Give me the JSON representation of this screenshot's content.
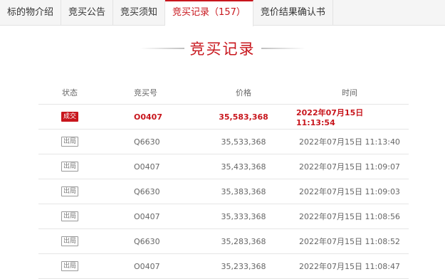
{
  "tabs": [
    {
      "label": "标的物介绍"
    },
    {
      "label": "竞买公告"
    },
    {
      "label": "竞买须知"
    },
    {
      "label": "竞买记录（157）"
    },
    {
      "label": "竞价结果确认书"
    }
  ],
  "active_tab": 3,
  "section_title": "竞买记录",
  "table": {
    "headers": {
      "status": "状态",
      "bid_no": "竞买号",
      "price": "价格",
      "time": "时间"
    },
    "rows": [
      {
        "status": "成交",
        "bid_no": "O0407",
        "price": "35,583,368",
        "time": "2022年07月15日 11:13:54",
        "winner": true
      },
      {
        "status": "出局",
        "bid_no": "Q6630",
        "price": "35,533,368",
        "time": "2022年07月15日 11:13:40",
        "winner": false
      },
      {
        "status": "出局",
        "bid_no": "O0407",
        "price": "35,433,368",
        "time": "2022年07月15日 11:09:07",
        "winner": false
      },
      {
        "status": "出局",
        "bid_no": "Q6630",
        "price": "35,383,368",
        "time": "2022年07月15日 11:09:03",
        "winner": false
      },
      {
        "status": "出局",
        "bid_no": "O0407",
        "price": "35,333,368",
        "time": "2022年07月15日 11:08:56",
        "winner": false
      },
      {
        "status": "出局",
        "bid_no": "Q6630",
        "price": "35,283,368",
        "time": "2022年07月15日 11:08:52",
        "winner": false
      },
      {
        "status": "出局",
        "bid_no": "O0407",
        "price": "35,233,368",
        "time": "2022年07月15日 11:08:47",
        "winner": false
      }
    ]
  },
  "colors": {
    "accent": "#c8161d",
    "tab_bg": "#f5f5f5",
    "border": "#e6e6e6"
  }
}
